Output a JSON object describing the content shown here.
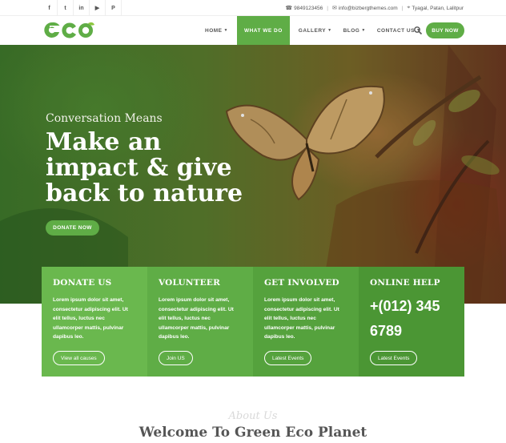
{
  "topbar": {
    "social": [
      {
        "icon": "facebook-icon",
        "glyph": "f"
      },
      {
        "icon": "twitter-icon",
        "glyph": "t"
      },
      {
        "icon": "linkedin-icon",
        "glyph": "in"
      },
      {
        "icon": "youtube-icon",
        "glyph": "▶"
      },
      {
        "icon": "pinterest-icon",
        "glyph": "P"
      }
    ],
    "phone": "9849123456",
    "email": "info@bizbergthemes.com",
    "location": "Tyagal, Patan, Lalitpur"
  },
  "header": {
    "logo_text": "eco",
    "nav": [
      {
        "label": "HOME",
        "dropdown": true
      },
      {
        "label": "WHAT WE DO",
        "dropdown": false
      },
      {
        "label": "GALLERY",
        "dropdown": true
      },
      {
        "label": "BLOG",
        "dropdown": true
      },
      {
        "label": "CONTACT US",
        "dropdown": true
      }
    ],
    "active_nav": "WHAT WE DO",
    "buy_label": "BUY NOW"
  },
  "hero": {
    "subtitle": "Conversation Means",
    "title": "Make an impact & give back to nature",
    "donate_label": "DONATE NOW"
  },
  "boxes": [
    {
      "title": "DONATE US",
      "text": "Lorem ipsum dolor sit amet, consectetur adipiscing elit. Ut elit tellus, luctus nec ullamcorper mattis, pulvinar dapibus leo.",
      "button": "View all causes"
    },
    {
      "title": "VOLUNTEER",
      "text": "Lorem ipsum dolor sit amet, consectetur adipiscing elit. Ut elit tellus, luctus nec ullamcorper mattis, pulvinar dapibus leo.",
      "button": "Join US"
    },
    {
      "title": "GET INVOLVED",
      "text": "Lorem ipsum dolor sit amet, consectetur adipiscing elit. Ut elit tellus, luctus nec ullamcorper mattis, pulvinar dapibus leo.",
      "button": "Latest Events"
    },
    {
      "title": "ONLINE HELP",
      "phone": "+(012) 345 6789",
      "button": "Latest Events"
    }
  ],
  "about": {
    "script": "About Us",
    "title": "Welcome To Green Eco Planet"
  },
  "colors": {
    "accent": "#5fad46",
    "text_dark": "#555555"
  }
}
